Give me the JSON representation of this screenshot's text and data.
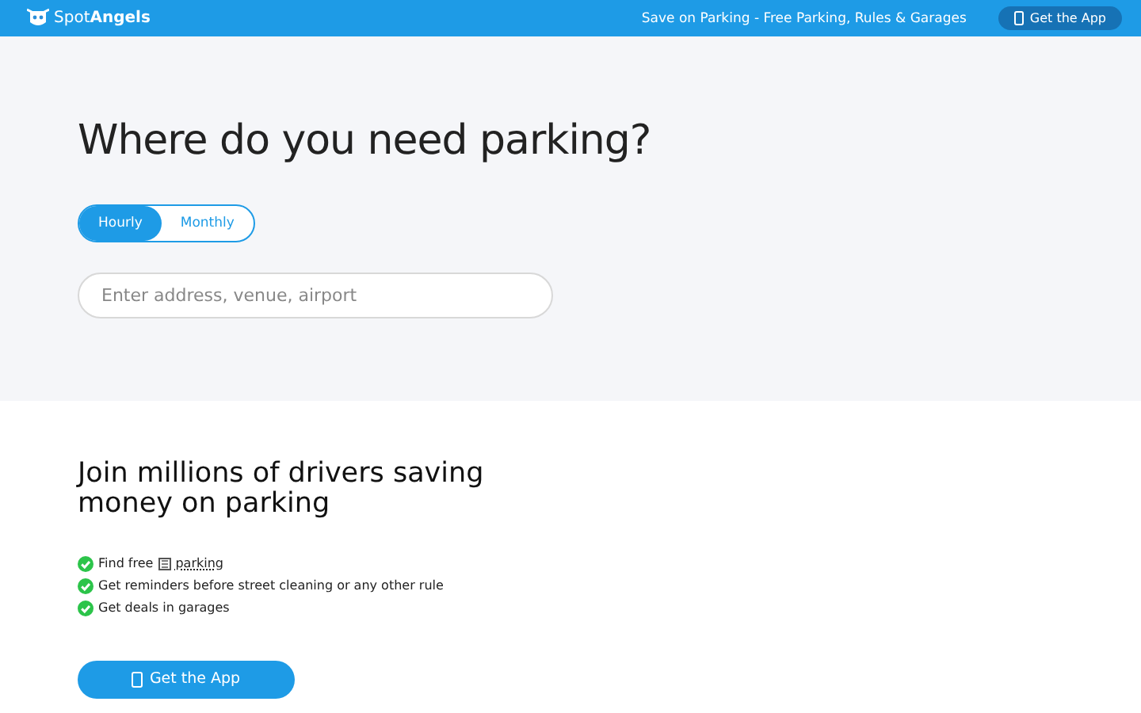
{
  "header": {
    "logo": "Spot**Angels**",
    "tagline": "Save on Parking - Free Parking, Rules & Garages",
    "button": "Get the App"
  },
  "hero": {
    "title": "Where do you need parking?",
    "modes": [
      {
        "label": "Hourly",
        "selected": true
      },
      {
        "label": "Monthly",
        "selected": false
      }
    ],
    "search": {
      "placeholder": "Enter address, venue, airport"
    }
  },
  "promo": {
    "title": "Join millions of drivers saving money on parking",
    "features": [
      {
        "parts": [
          "Find free",
          "parking"
        ]
      },
      {
        "parts": [
          "Get reminders before street cleaning or any other rule"
        ]
      },
      {
        "parts": [
          "Get deals in garages"
        ]
      }
    ],
    "button": "Get the App"
  }
}
